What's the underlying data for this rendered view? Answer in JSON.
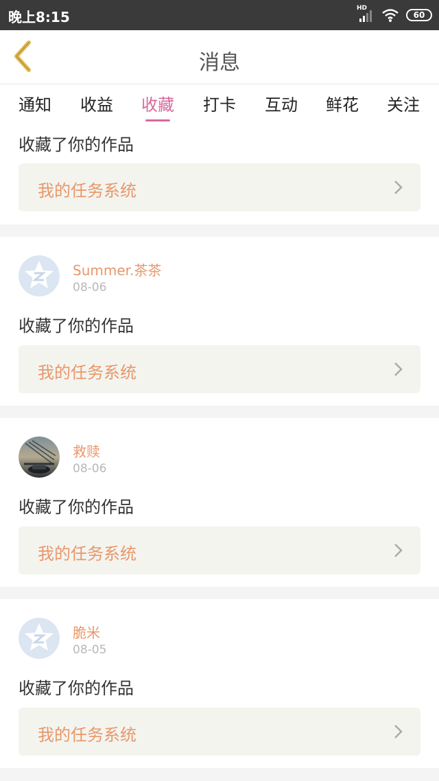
{
  "status_bar": {
    "time": "晚上8:15",
    "network": "HD",
    "battery": "60"
  },
  "header": {
    "title": "消息"
  },
  "tabs": [
    {
      "label": "通知"
    },
    {
      "label": "收益"
    },
    {
      "label": "收藏"
    },
    {
      "label": "打卡"
    },
    {
      "label": "互动"
    },
    {
      "label": "鲜花"
    },
    {
      "label": "关注"
    }
  ],
  "active_tab": "收藏",
  "messages": [
    {
      "action": "收藏了你的作品",
      "link_label": "我的任务系统"
    },
    {
      "username": "Summer.茶茶",
      "date": "08-06",
      "avatar": "qq-default-avatar",
      "action": "收藏了你的作品",
      "link_label": "我的任务系统"
    },
    {
      "username": "救赎",
      "date": "08-06",
      "avatar": "photo-avatar",
      "action": "收藏了你的作品",
      "link_label": "我的任务系统"
    },
    {
      "username": "脆米",
      "date": "08-05",
      "avatar": "qq-default-avatar",
      "action": "收藏了你的作品",
      "link_label": "我的任务系统"
    }
  ],
  "colors": {
    "accent": "#d9689b",
    "username": "#e8976a",
    "back_icon": "#e2b84a"
  }
}
